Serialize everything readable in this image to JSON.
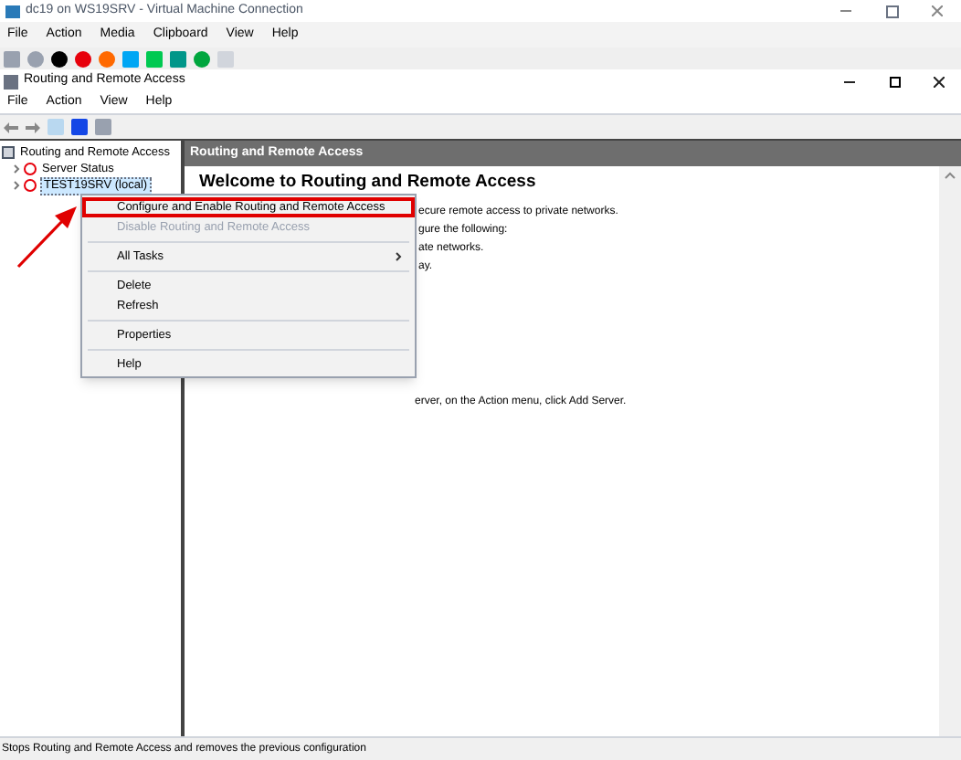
{
  "window": {
    "title": "dc19 on WS19SRV - Virtual Machine Connection"
  },
  "vm_menu": [
    "File",
    "Action",
    "Media",
    "Clipboard",
    "View",
    "Help"
  ],
  "console": {
    "title": "Routing and Remote Access",
    "menu": [
      "File",
      "Action",
      "View",
      "Help"
    ]
  },
  "tree": [
    {
      "label": "Routing and Remote Access",
      "selected": false,
      "children": [
        {
          "label": "Server Status",
          "selected": false
        },
        {
          "label": "TEST19SRV (local)",
          "selected": true
        }
      ]
    }
  ],
  "content": {
    "header": "Routing and Remote Access",
    "heading": "Welcome to Routing and Remote Access",
    "lines": [
      "ecure remote access to private networks.",
      "gure the following:",
      "ate networks.",
      "ay."
    ],
    "footer_line": "erver, on the Action menu, click Add Server."
  },
  "context_menu": [
    {
      "kind": "item",
      "label": "Configure and Enable Routing and Remote Access",
      "disabled": false,
      "highlighted": true
    },
    {
      "kind": "item",
      "label": "Disable Routing and Remote Access",
      "disabled": true,
      "highlighted": false
    },
    {
      "kind": "separator"
    },
    {
      "kind": "submenu",
      "label": "All Tasks",
      "disabled": false,
      "highlighted": false
    },
    {
      "kind": "separator"
    },
    {
      "kind": "item",
      "label": "Delete",
      "disabled": false,
      "highlighted": false
    },
    {
      "kind": "item",
      "label": "Refresh",
      "disabled": false,
      "highlighted": false
    },
    {
      "kind": "separator"
    },
    {
      "kind": "item",
      "label": "Properties",
      "disabled": false,
      "highlighted": false
    },
    {
      "kind": "separator"
    },
    {
      "kind": "item",
      "label": "Help",
      "disabled": false,
      "highlighted": false
    }
  ],
  "status_bar": "Stops Routing and Remote Access and removes the previous configuration"
}
